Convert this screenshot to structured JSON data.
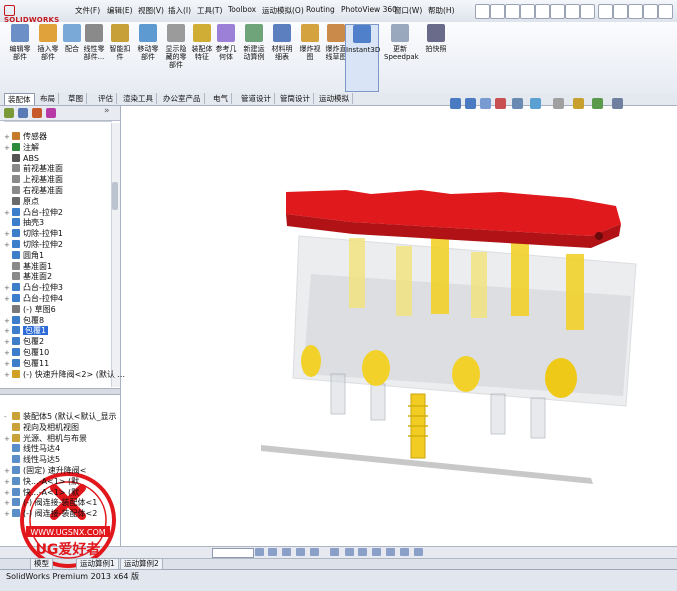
{
  "app": {
    "logo_text": "SOLIDWORKS",
    "menu": [
      "文件(F)",
      "编辑(E)",
      "视图(V)",
      "插入(I)",
      "工具(T)",
      "Toolbox",
      "运动模拟(O)",
      "Routing",
      "PhotoView 360",
      "窗口(W)",
      "帮助(H)"
    ]
  },
  "toolbar": {
    "tools": [
      {
        "label": "编辑零\n部件"
      },
      {
        "label": "插入零\n部件"
      },
      {
        "label": "配合"
      },
      {
        "label": "线性零\n部件..."
      },
      {
        "label": "智能扣\n件"
      },
      {
        "label": "移动零\n部件"
      },
      {
        "label": "显示隐\n藏的零\n部件"
      },
      {
        "label": "装配体\n特征"
      },
      {
        "label": "参考几\n何体"
      },
      {
        "label": "新建运\n动算例"
      },
      {
        "label": "材料明\n细表"
      },
      {
        "label": "爆炸视\n图"
      },
      {
        "label": "爆炸直\n线草图"
      },
      {
        "label": "Instant3D"
      },
      {
        "label": "更新\nSpeedpak"
      },
      {
        "label": "拍快照"
      }
    ]
  },
  "tabs": [
    "装配体",
    "布局",
    "草图",
    "评估",
    "渲染工具",
    "办公室产品",
    "电气",
    "管道设计",
    "管筒设计",
    "运动模拟"
  ],
  "tree": {
    "top_items": [
      {
        "text": "传感器",
        "exp": "+"
      },
      {
        "text": "注解",
        "exp": "+"
      },
      {
        "text": "ABS",
        "exp": ""
      },
      {
        "text": "前视基准面",
        "exp": ""
      },
      {
        "text": "上视基准面",
        "exp": ""
      },
      {
        "text": "右视基准面",
        "exp": ""
      },
      {
        "text": "原点",
        "exp": ""
      },
      {
        "text": "凸台-拉伸2",
        "exp": "+"
      },
      {
        "text": "抽壳3",
        "exp": ""
      },
      {
        "text": "切除-拉伸1",
        "exp": "+"
      },
      {
        "text": "切除-拉伸2",
        "exp": "+"
      },
      {
        "text": "圆角1",
        "exp": ""
      },
      {
        "text": "基准面1",
        "exp": ""
      },
      {
        "text": "基准面2",
        "exp": ""
      },
      {
        "text": "凸台-拉伸3",
        "exp": "+"
      },
      {
        "text": "凸台-拉伸4",
        "exp": "+"
      },
      {
        "text": "(-) 草图6",
        "exp": ""
      },
      {
        "text": "包覆8",
        "exp": "+"
      },
      {
        "text": "包覆1",
        "exp": "+",
        "selected": true
      },
      {
        "text": "包覆2",
        "exp": "+"
      },
      {
        "text": "包覆10",
        "exp": "+"
      },
      {
        "text": "包覆11",
        "exp": "+"
      },
      {
        "text": "(-) 快速升降阀<2> (默认 ...",
        "exp": "+"
      }
    ],
    "bottom_items": [
      {
        "text": "装配体5 (默认<默认_显示",
        "exp": "-"
      },
      {
        "text": "视向及相机视图",
        "exp": ""
      },
      {
        "text": "光源、相机与布景",
        "exp": "+"
      },
      {
        "text": "线性马达4",
        "exp": ""
      },
      {
        "text": "线性马达5",
        "exp": ""
      },
      {
        "text": "(固定) 速升降阀<",
        "exp": "+"
      },
      {
        "text": "快...-A<1> (默",
        "exp": "+"
      },
      {
        "text": "快...-A<1> (默",
        "exp": "+"
      },
      {
        "text": "(-) 阀连接-装配体<1",
        "exp": "+"
      },
      {
        "text": "(-) 阀连接-装配体<2",
        "exp": "+"
      }
    ]
  },
  "bottom_tabs": [
    "模型",
    "运动算例1",
    "运动算例2"
  ],
  "status_text": "SolidWorks Premium 2013 x64 版",
  "watermark": {
    "text": "UG爱好者",
    "url": "WWW.UGSNX.COM"
  },
  "colors": {
    "red_part": "#e0191c",
    "yellow_part": "#f2d22a",
    "accent": "#2e6bd6"
  }
}
